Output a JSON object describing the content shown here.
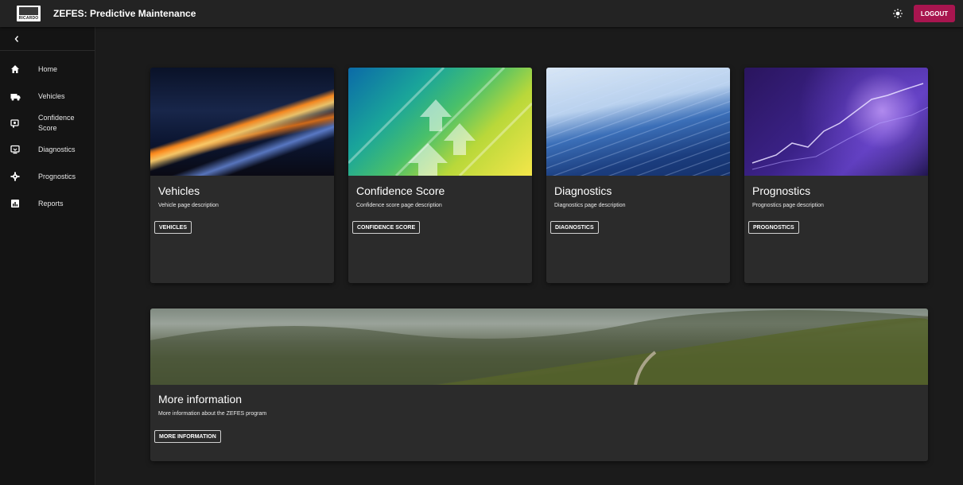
{
  "app": {
    "logo_text": "RICARDO",
    "title": "ZEFES: Predictive Maintenance",
    "theme_icon": "sun-icon",
    "logout_label": "LOGOUT",
    "accent_color": "#a8154f"
  },
  "sidebar": {
    "collapse_icon": "chevron-left-icon",
    "items": [
      {
        "label": "Home",
        "icon": "home-icon"
      },
      {
        "label": "Vehicles",
        "icon": "truck-icon"
      },
      {
        "label": "Confidence Score",
        "icon": "gauge-icon"
      },
      {
        "label": "Diagnostics",
        "icon": "monitor-icon"
      },
      {
        "label": "Prognostics",
        "icon": "gear-icon"
      },
      {
        "label": "Reports",
        "icon": "report-chart-icon"
      }
    ]
  },
  "cards": [
    {
      "title": "Vehicles",
      "description": "Vehicle page description",
      "button": "VEHICLES"
    },
    {
      "title": "Confidence Score",
      "description": "Confidence score page description",
      "button": "CONFIDENCE SCORE"
    },
    {
      "title": "Diagnostics",
      "description": "Diagnostics page description",
      "button": "DIAGNOSTICS"
    },
    {
      "title": "Prognostics",
      "description": "Prognostics page description",
      "button": "PROGNOSTICS"
    }
  ],
  "info_card": {
    "title": "More information",
    "description": "More information about the ZEFES program",
    "button": "MORE INFORMATION"
  }
}
